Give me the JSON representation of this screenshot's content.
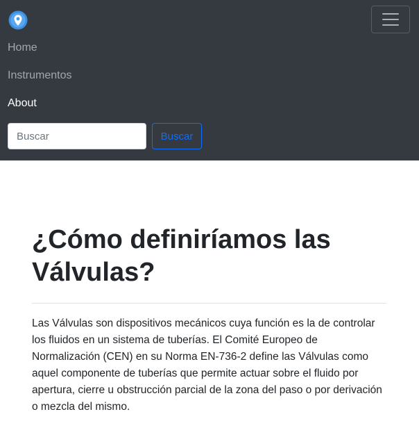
{
  "navbar": {
    "logo_icon": "pin-logo-icon",
    "toggler_icon": "hamburger-menu-icon",
    "links": [
      {
        "label": "Home",
        "active": false
      },
      {
        "label": "Instrumentos",
        "active": false
      },
      {
        "label": "About",
        "active": true
      }
    ],
    "search": {
      "placeholder": "Buscar",
      "value": "",
      "button_label": "Buscar"
    },
    "colors": {
      "background": "#343a40",
      "link": "rgba(255,255,255,0.55)",
      "link_active": "#ffffff",
      "accent": "#0d6efd"
    }
  },
  "main": {
    "title": "¿Cómo definiríamos las Válvulas?",
    "paragraph": "Las Válvulas son dispositivos mecánicos cuya función es la de controlar los fluidos en un sistema de tuberías. El Comité Europeo de Normalización (CEN) en su Norma EN-736-2 define las Válvulas como aquel componente de tuberías que permite actuar sobre el fluido por apertura, cierre u obstrucción parcial de la zona del paso o por derivación o mezcla del mismo."
  }
}
